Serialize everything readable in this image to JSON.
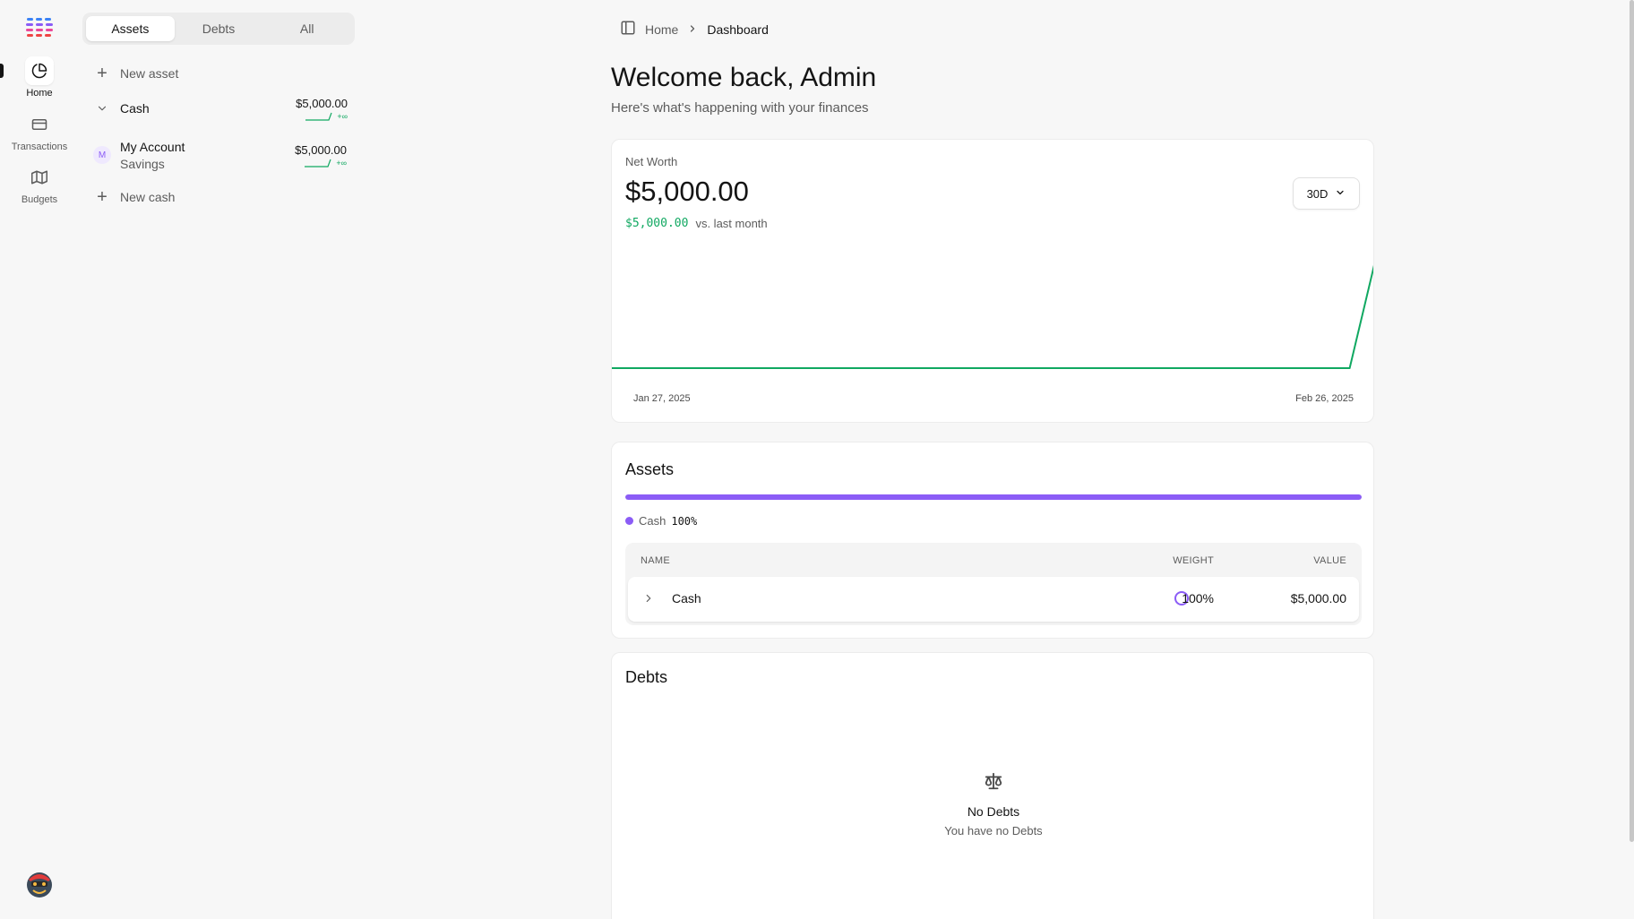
{
  "nav": {
    "items": [
      {
        "label": "Home",
        "icon": "pie-chart-icon",
        "active": true
      },
      {
        "label": "Transactions",
        "icon": "credit-card-icon",
        "active": false
      },
      {
        "label": "Budgets",
        "icon": "map-icon",
        "active": false
      }
    ]
  },
  "accounts": {
    "tabs": [
      {
        "label": "Assets",
        "active": true
      },
      {
        "label": "Debts",
        "active": false
      },
      {
        "label": "All",
        "active": false
      }
    ],
    "new_asset_label": "New asset",
    "group": {
      "name": "Cash",
      "amount": "$5,000.00",
      "change": "+∞"
    },
    "account": {
      "initial": "M",
      "name": "My Account",
      "subtype": "Savings",
      "amount": "$5,000.00",
      "change": "+∞"
    },
    "new_cash_label": "New cash"
  },
  "breadcrumb": {
    "home": "Home",
    "current": "Dashboard"
  },
  "header": {
    "title": "Welcome back, Admin",
    "subtitle": "Here's what's happening with your finances"
  },
  "net_worth": {
    "label": "Net Worth",
    "value": "$5,000.00",
    "change_value": "$5,000.00",
    "change_label": "vs. last month",
    "period": "30D"
  },
  "chart_data": {
    "type": "line",
    "x": [
      "2025-01-27",
      "2025-02-25",
      "2025-02-26"
    ],
    "y": [
      0,
      0,
      5000
    ],
    "x_tick_labels": [
      "Jan 27, 2025",
      "Feb 26, 2025"
    ],
    "ylim": [
      0,
      6500
    ],
    "grid": false,
    "line_color": "#10a861"
  },
  "assets": {
    "title": "Assets",
    "allocation": [
      {
        "name": "Cash",
        "percent": "100%",
        "share": 1.0,
        "color": "#8b5cf6"
      }
    ],
    "columns": {
      "name": "NAME",
      "weight": "WEIGHT",
      "value": "VALUE"
    },
    "rows": [
      {
        "name": "Cash",
        "weight": "100%",
        "value": "$5,000.00"
      }
    ]
  },
  "debts": {
    "title": "Debts",
    "empty_title": "No Debts",
    "empty_subtitle": "You have no Debts"
  },
  "colors": {
    "positive": "#10a861",
    "accent": "#8b5cf6",
    "text": "#141414",
    "muted": "#5c5c5c"
  }
}
